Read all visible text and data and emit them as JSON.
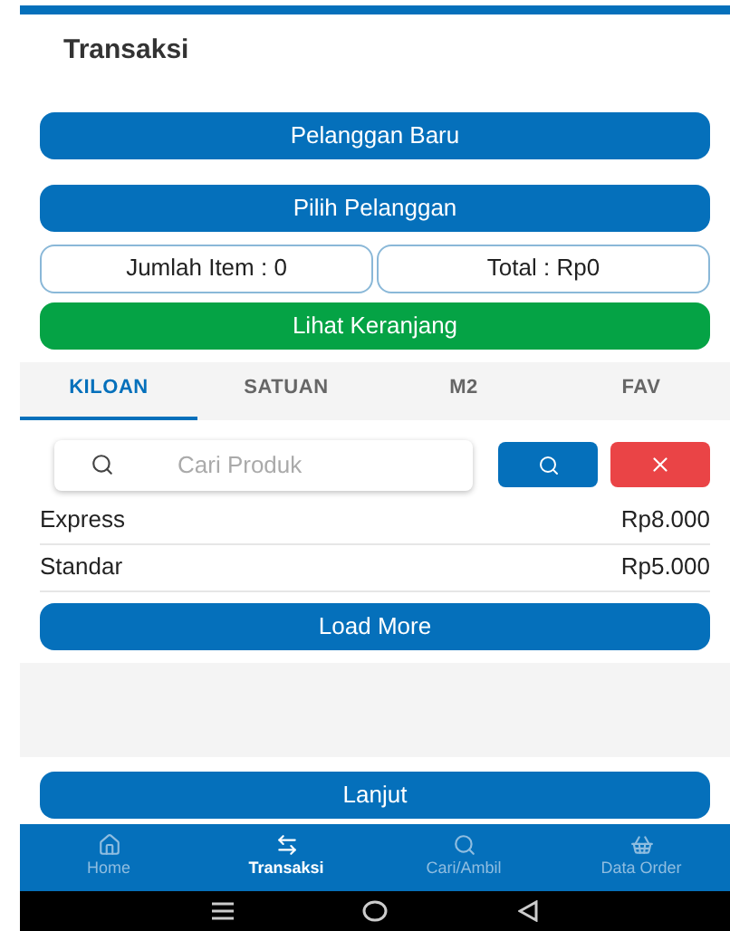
{
  "header": {
    "title": "Transaksi"
  },
  "customer_buttons": [
    "Pelanggan Baru",
    "Pilih Pelanggan"
  ],
  "summary": {
    "item_count": "Jumlah Item : 0",
    "total": "Total : Rp0"
  },
  "cart_button": "Lihat Keranjang",
  "tabs": [
    {
      "label": "KILOAN",
      "selected": true
    },
    {
      "label": "SATUAN",
      "selected": false
    },
    {
      "label": "M2",
      "selected": false
    },
    {
      "label": "FAV",
      "selected": false
    }
  ],
  "search": {
    "placeholder": "Cari Produk"
  },
  "products": [
    {
      "name": "Express",
      "price": "Rp8.000"
    },
    {
      "name": "Standar",
      "price": "Rp5.000"
    }
  ],
  "load_more": "Load More",
  "next_button": "Lanjut",
  "bottom_nav": [
    {
      "label": "Home",
      "selected": false
    },
    {
      "label": "Transaksi",
      "selected": true
    },
    {
      "label": "Cari/Ambil",
      "selected": false
    },
    {
      "label": "Data Order",
      "selected": false
    }
  ]
}
